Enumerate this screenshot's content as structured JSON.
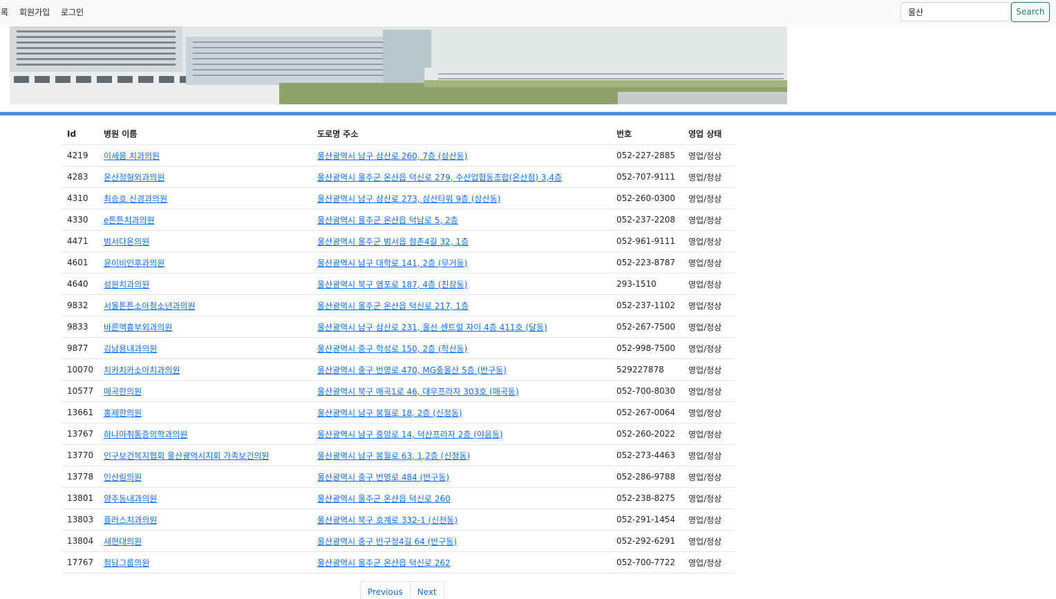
{
  "nav": {
    "items": [
      "등록",
      "회원가입",
      "로그인"
    ]
  },
  "search": {
    "value": "울산",
    "button_label": "Search"
  },
  "table": {
    "headers": [
      "Id",
      "병원 이름",
      "도로명 주소",
      "번호",
      "영업 상태"
    ],
    "rows": [
      [
        "4219",
        "이세움 치과의원",
        "울산광역시 남구 삼산로 260, 7층 (삼산동)",
        "052-227-2885",
        "영업/정상"
      ],
      [
        "4283",
        "온산정형외과의원",
        "울산광역시 울주군 온산읍 덕신로 279, 수산업협동조합(온산점) 3,4층",
        "052-707-9111",
        "영업/정상"
      ],
      [
        "4310",
        "최승호 신경과의원",
        "울산광역시 남구 삼산로 273, 삼산타워 9층 (삼산동)",
        "052-260-0300",
        "영업/정상"
      ],
      [
        "4330",
        "e튼튼치과의원",
        "울산광역시 울주군 온산읍 덕남로 5, 2층",
        "052-237-2208",
        "영업/정상"
      ],
      [
        "4471",
        "범서다온의원",
        "울산광역시 울주군 범서읍 점촌4길 32, 1층",
        "052-961-9111",
        "영업/정상"
      ],
      [
        "4601",
        "윤이비인후과의원",
        "울산광역시 남구 대학로 141, 2층 (무거동)",
        "052-223-8787",
        "영업/정상"
      ],
      [
        "4640",
        "성원치과의원",
        "울산광역시 북구 염포로 187, 4층 (진장동)",
        "293-1510",
        "영업/정상"
      ],
      [
        "9832",
        "서울튼튼소아청소년과의원",
        "울산광역시 울주군 온산읍 덕신로 217, 1층",
        "052-237-1102",
        "영업/정상"
      ],
      [
        "9833",
        "바른맥흉부외과의원",
        "울산광역시 남구 삼산로 231, 울산 센트럴 자이 4층 411호 (달동)",
        "052-267-7500",
        "영업/정상"
      ],
      [
        "9877",
        "김남용내과의원",
        "울산광역시 중구 학성로 150, 2층 (학산동)",
        "052-998-7500",
        "영업/정상"
      ],
      [
        "10070",
        "치카치카소아치과의원",
        "울산광역시 중구 번영로 470, MG중울산 5층 (반구동)",
        "529227878",
        "영업/정상"
      ],
      [
        "10577",
        "매곡한의원",
        "울산광역시 북구 매곡1로 46, 대우프라자 303호 (매곡동)",
        "052-700-8030",
        "영업/정상"
      ],
      [
        "13661",
        "홍제한의원",
        "울산광역시 남구 봉월로 18, 2층 (신정동)",
        "052-267-0064",
        "영업/정상"
      ],
      [
        "13767",
        "하나마취통증의학과의원",
        "울산광역시 남구 중앙로 14, 덕산프라자 2층 (야음동)",
        "052-260-2022",
        "영업/정상"
      ],
      [
        "13770",
        "인구보건복지협회 울산광역시지회 가족보건의원",
        "울산광역시 남구 봉월로 63, 1,2층 (신정동)",
        "052-273-4463",
        "영업/정상"
      ],
      [
        "13778",
        "인산림의원",
        "울산광역시 중구 번영로 484 (반구동)",
        "052-286-9788",
        "영업/정상"
      ],
      [
        "13801",
        "양주동내과의원",
        "울산광역시 울주군 온산읍 덕신로 260",
        "052-238-8275",
        "영업/정상"
      ],
      [
        "13803",
        "플러스치과의원",
        "울산광역시 북구 호계로 332-1 (신천동)",
        "052-291-1454",
        "영업/정상"
      ],
      [
        "13804",
        "새현대의원",
        "울산광역시 중구 반구정4길 64 (반구동)",
        "052-292-6291",
        "영업/정상"
      ],
      [
        "17767",
        "청담그룹의원",
        "울산광역시 울주군 온산읍 덕신로 262",
        "052-700-7722",
        "영업/정상"
      ]
    ]
  },
  "pagination": {
    "previous": "Previous",
    "next": "Next"
  },
  "colors": {
    "link": "#0d6efd",
    "accent_line": "#4a8fe0",
    "search_button": "#198754"
  }
}
